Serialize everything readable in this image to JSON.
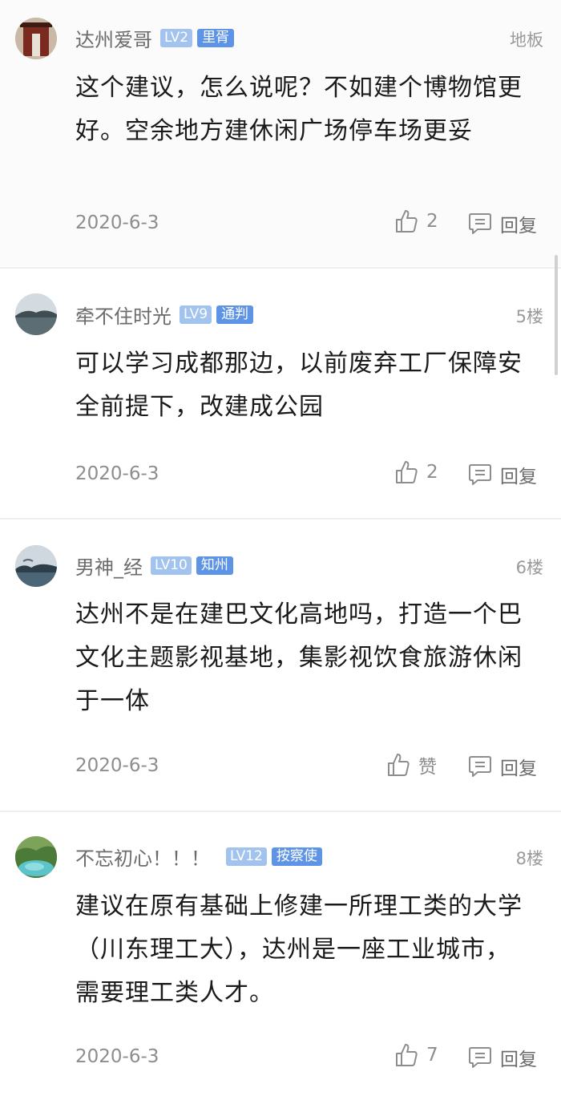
{
  "comments": [
    {
      "username": "达州爱哥",
      "level": "LV2",
      "title": "里胥",
      "floor": "地板",
      "content": "这个建议，怎么说呢？不如建个博物馆更好。空余地方建休闲广场停车场更妥",
      "date": "2020-6-3",
      "like": "2",
      "reply": "回复"
    },
    {
      "username": "牵不住时光",
      "level": "LV9",
      "title": "通判",
      "floor": "5楼",
      "content": "可以学习成都那边，以前废弃工厂保障安全前提下，改建成公园",
      "date": "2020-6-3",
      "like": "2",
      "reply": "回复"
    },
    {
      "username": "男神_经",
      "level": "LV10",
      "title": "知州",
      "floor": "6楼",
      "content": "达州不是在建巴文化高地吗，打造一个巴文化主题影视基地，集影视饮食旅游休闲于一体",
      "date": "2020-6-3",
      "like": "赞",
      "reply": "回复"
    },
    {
      "username": "不忘初心！！！",
      "level": "LV12",
      "title": "按察使",
      "floor": "8楼",
      "content": "建议在原有基础上修建一所理工类的大学（川东理工大），达州是一座工业城市，需要理工类人才。",
      "date": "2020-6-3",
      "like": "7",
      "reply": "回复"
    }
  ],
  "icons": {
    "like": "thumbs-up-icon",
    "reply": "reply-bubble-icon"
  },
  "colors": {
    "level_badge": "#a3c3ef",
    "title_badge": "#5e94e6",
    "text": "#1a1a1a",
    "meta": "#8d8d8d"
  }
}
